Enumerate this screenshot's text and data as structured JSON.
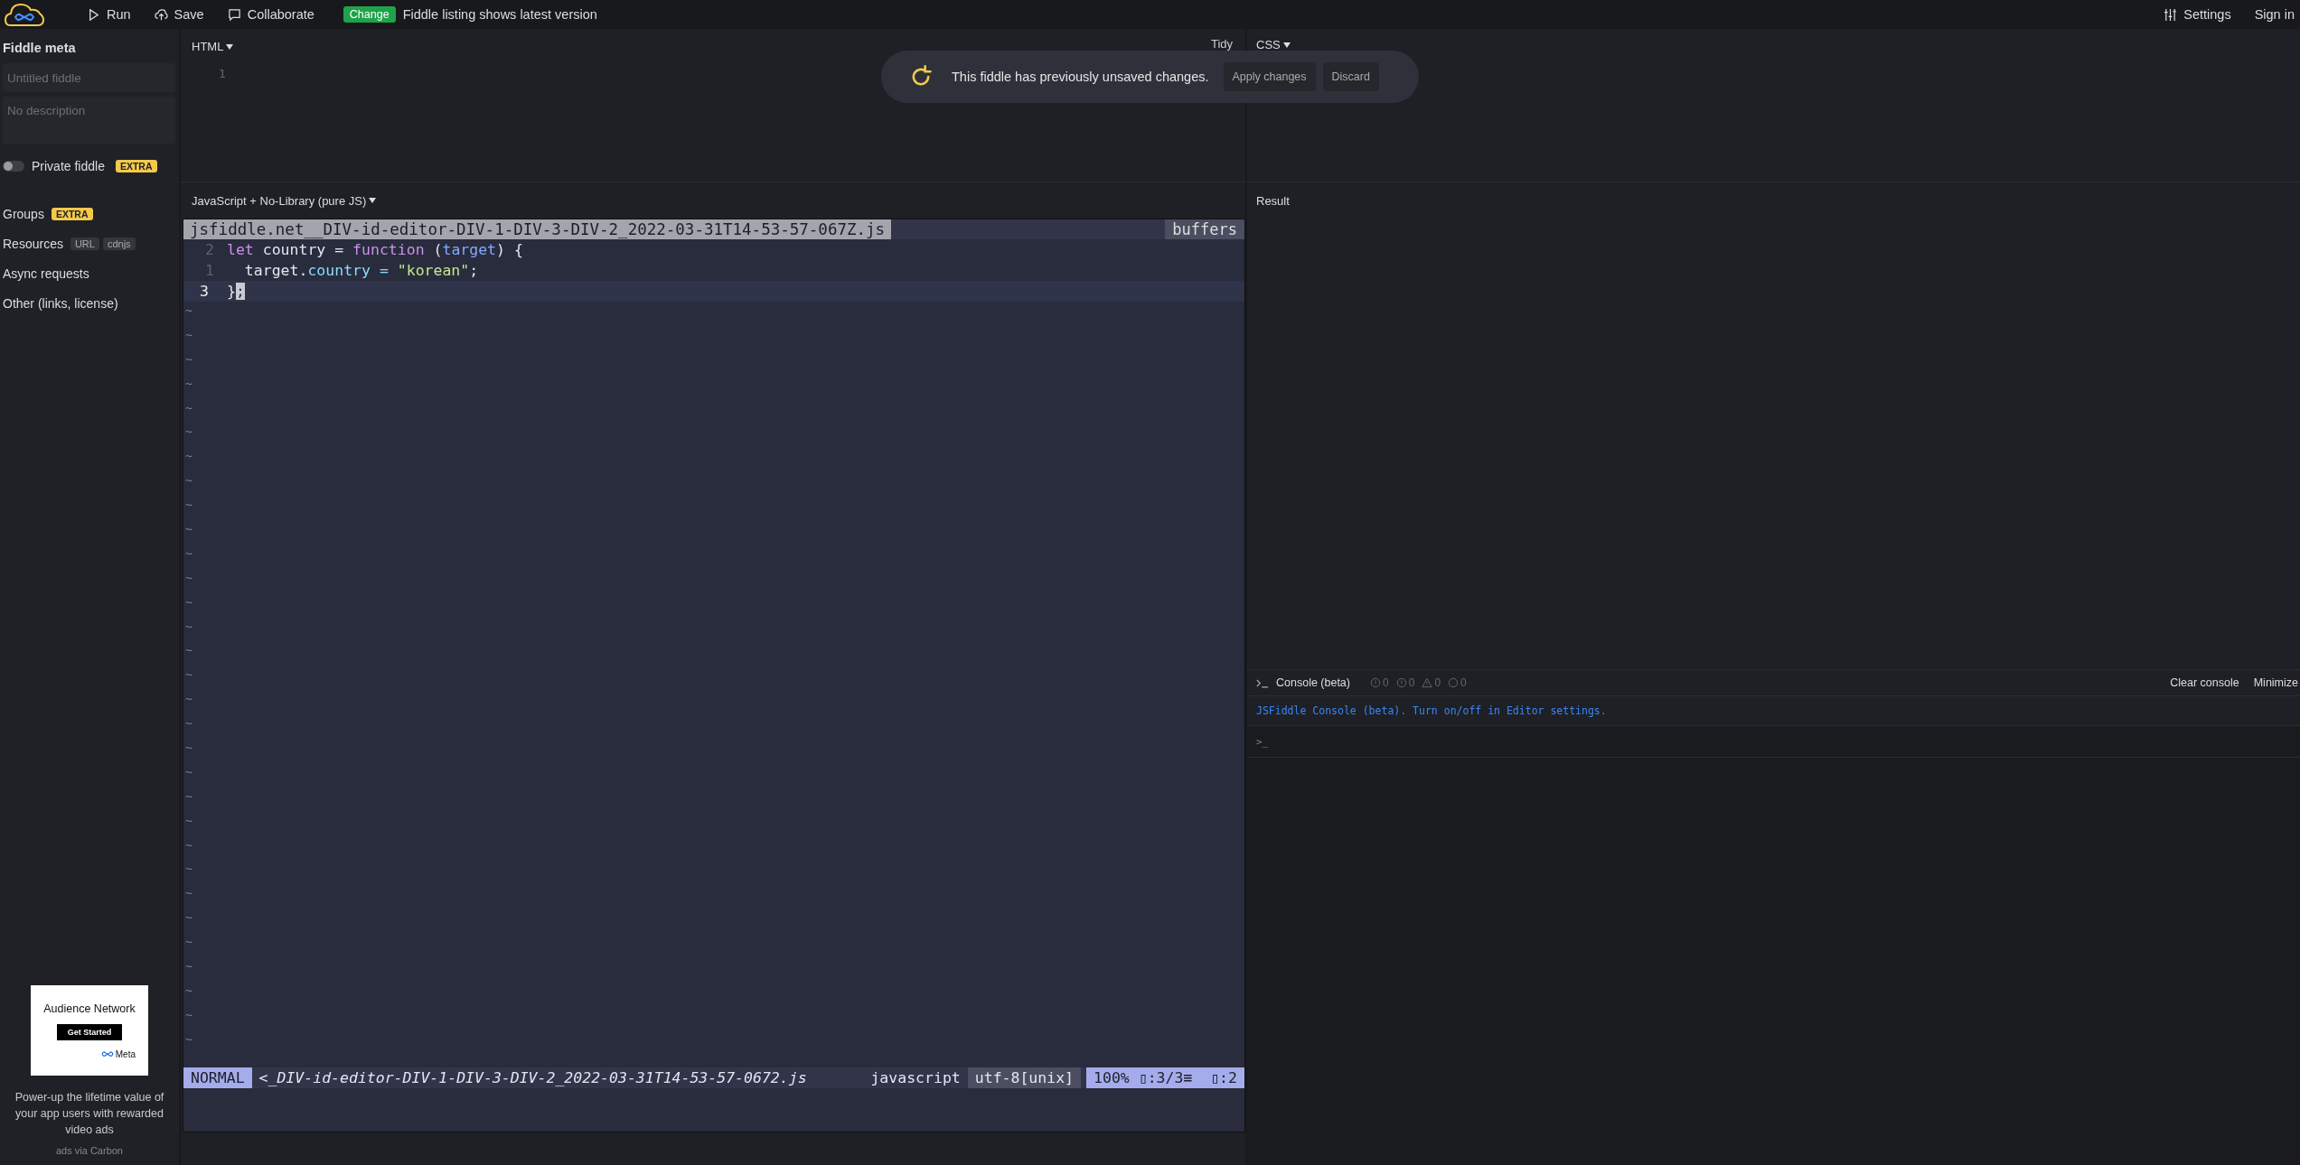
{
  "topbar": {
    "actions": [
      {
        "label": "Run"
      },
      {
        "label": "Save"
      },
      {
        "label": "Collaborate"
      }
    ],
    "notice": {
      "badge": "Change",
      "text": "Fiddle listing shows latest version"
    },
    "right": [
      {
        "label": "Settings"
      },
      {
        "label": "Sign in"
      }
    ]
  },
  "sidebar": {
    "title": "Fiddle meta",
    "title_placeholder": "Untitled fiddle",
    "description_placeholder": "No description",
    "private": {
      "label": "Private fiddle",
      "on": false,
      "badge": "EXTRA"
    },
    "sections": [
      {
        "label": "Groups",
        "tags": [
          {
            "text": "EXTRA",
            "kind": "extra"
          }
        ]
      },
      {
        "label": "Resources",
        "tags": [
          {
            "text": "URL",
            "kind": "plain"
          },
          {
            "text": "cdnjs",
            "kind": "plain"
          }
        ]
      },
      {
        "label": "Async requests"
      },
      {
        "label": "Other (links, license)"
      }
    ]
  },
  "ad": {
    "headline": "Audience Network",
    "button": "Get Started",
    "brand": "Meta",
    "text": "Power-up the lifetime value of your app users with rewarded video ads",
    "footer": "ads via Carbon"
  },
  "html_panel": {
    "language": "HTML",
    "line_numbers": [
      "1"
    ],
    "tidy": "Tidy"
  },
  "css_panel": {
    "language": "CSS"
  },
  "toast": {
    "text": "This fiddle has previously unsaved changes.",
    "buttons": [
      "Apply changes",
      "Discard"
    ]
  },
  "js_panel": {
    "language": "JavaScript + No-Library (pure JS)",
    "filename": "jsfiddle.net__DIV-id-editor-DIV-1-DIV-3-DIV-2_2022-03-31T14-53-57-067Z.js",
    "buffers": "buffers",
    "lines": [
      {
        "number": "2",
        "current": false,
        "tokens": [
          {
            "text": "let",
            "kind": "keyword"
          },
          {
            "text": " country = ",
            "kind": "plain"
          },
          {
            "text": "function",
            "kind": "keyword"
          },
          {
            "text": " (",
            "kind": "plain"
          },
          {
            "text": "target",
            "kind": "param"
          },
          {
            "text": ") {",
            "kind": "plain"
          }
        ]
      },
      {
        "number": "1",
        "current": false,
        "tokens": [
          {
            "text": "  target.",
            "kind": "plain"
          },
          {
            "text": "country",
            "kind": "property"
          },
          {
            "text": " = ",
            "kind": "operator"
          },
          {
            "text": "\"korean\"",
            "kind": "string"
          },
          {
            "text": ";",
            "kind": "plain"
          }
        ]
      },
      {
        "number": "3",
        "current": true,
        "tokens": [
          {
            "text": "}",
            "kind": "plain"
          },
          {
            "text": ";",
            "kind": "cursor"
          }
        ]
      }
    ],
    "empty_line_markers": [
      "~",
      "~",
      "~",
      "~",
      "~",
      "~",
      "~",
      "~",
      "~",
      "~",
      "~",
      "~",
      "~",
      "~",
      "~",
      "~",
      "~",
      "~",
      "~",
      "~",
      "~",
      "~",
      "~",
      "~",
      "~",
      "~",
      "~",
      "~",
      "~",
      "~",
      "~"
    ],
    "status": {
      "mode": "NORMAL",
      "file": "<_DIV-id-editor-DIV-1-DIV-3-DIV-2_2022-03-31T14-53-57-0672.js",
      "filetype": "javascript",
      "encoding": "utf-8[unix]",
      "position": "100% ▯:3/3≡  ▯:2"
    }
  },
  "result": {
    "label": "Result"
  },
  "console": {
    "title": "Console (beta)",
    "counts": [
      {
        "value": "0"
      },
      {
        "value": "0"
      },
      {
        "value": "0"
      },
      {
        "value": "0"
      }
    ],
    "actions": [
      "Clear console",
      "Minimize"
    ],
    "message": "JSFiddle Console (beta). Turn on/off in Editor settings.",
    "prompt": ">_"
  }
}
